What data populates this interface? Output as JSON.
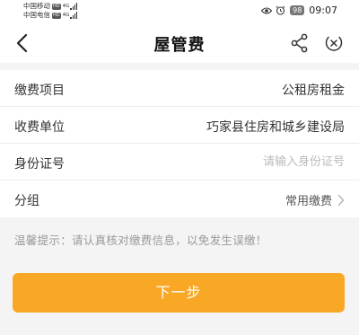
{
  "status_bar": {
    "carrier1": "中国移动",
    "carrier1_badge": "HD",
    "carrier2": "中国电信",
    "carrier2_badge": "HD",
    "network": "4G",
    "battery": "98",
    "time": "09:07"
  },
  "header": {
    "title": "屋管费"
  },
  "form": {
    "rows": [
      {
        "label": "缴费项目",
        "value": "公租房租金"
      },
      {
        "label": "收费单位",
        "value": "巧家县住房和城乡建设局"
      },
      {
        "label": "身份证号",
        "placeholder": "请输入身份证号"
      },
      {
        "label": "分组",
        "value": "常用缴费"
      }
    ]
  },
  "tip": "温馨提示：请认真核对缴费信息，以免发生误缴！",
  "next_button": "下一步",
  "colors": {
    "accent": "#f9a825",
    "background": "#f4f4f4"
  }
}
